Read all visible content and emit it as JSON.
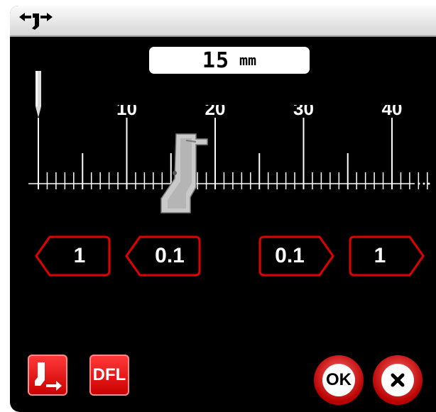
{
  "title_bar": {
    "icon": "needle-position-icon"
  },
  "readout": {
    "value": "15",
    "unit": "mm"
  },
  "ruler": {
    "labels": [
      "10",
      "20",
      "30",
      "40"
    ],
    "min_mm": 0,
    "max_mm": 44,
    "presser_foot_mm": 15
  },
  "step_buttons": [
    {
      "label": "1",
      "direction": "left"
    },
    {
      "label": "0.1",
      "direction": "left"
    },
    {
      "label": "0.1",
      "direction": "right"
    },
    {
      "label": "1",
      "direction": "right"
    }
  ],
  "bottom": {
    "foot_button_icon": "presser-foot-arrow-icon",
    "default_label": "DFL",
    "ok_label": "OK",
    "cancel_icon": "close-icon"
  },
  "colors": {
    "accent": "#e00000",
    "background": "#000000",
    "titlebar": "#e8e8e8"
  }
}
